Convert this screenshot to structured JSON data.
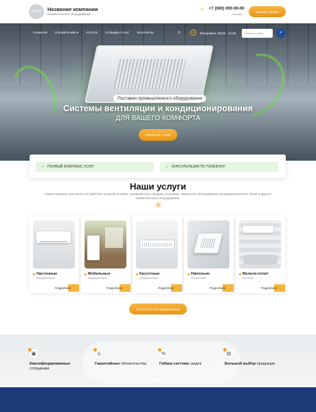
{
  "header": {
    "logo_text": "LOGO",
    "company_name": "Название компании",
    "company_sub": "Климатическое оборудование",
    "phone": "+7 (000) 000-00-00",
    "city": "г.Москва",
    "cta": "Заказать звонок"
  },
  "nav": {
    "items": [
      "Главная",
      "О компании",
      "Услуги",
      "Отзывы о нас",
      "Контакты"
    ],
    "hours": "Ежедневно: 09:00 - 21:00",
    "search_placeholder": "Поиск по сайту"
  },
  "hero": {
    "pill": "Поставки промышленного оборудования",
    "title": "Системы вентиляции и кондиционирования",
    "subtitle": "для вашего комфорта",
    "cta": "Связаться с нами"
  },
  "features": [
    "Полный комплекс услуг",
    "Консультация по телефону"
  ],
  "services": {
    "title": "Наши услуги",
    "description": "Наша компания уже много лет работает на рынке и имеет огромный опыт продаж, установки, сервисного обслуживания кондиционеров всех типов и другого климатического оборудования.",
    "items": [
      {
        "name": "Настенные",
        "sub": "кондиционеры",
        "more": "Подробнее"
      },
      {
        "name": "Мобильные",
        "sub": "кондиционеры",
        "more": "Подробнее"
      },
      {
        "name": "Кассетные",
        "sub": "кондиционеры",
        "more": "Подробнее"
      },
      {
        "name": "Напольно",
        "sub": "потолочные",
        "more": "Подробнее"
      },
      {
        "name": "Мульти-сплит",
        "sub": "системы",
        "more": "Подробнее"
      }
    ],
    "cta": "Посмотреть все предложения"
  },
  "advantages": [
    {
      "bold": "Квалифицированные",
      "rest": "сотрудники",
      "icon": "certificate-icon"
    },
    {
      "bold": "Гарантийные",
      "rest": "обязательства",
      "icon": "badge-icon"
    },
    {
      "bold": "Гибкая система",
      "rest": "скидок",
      "icon": "discount-icon"
    },
    {
      "bold": "Большой выбор",
      "rest": "продукции",
      "icon": "catalog-icon"
    }
  ],
  "colors": {
    "accent": "#ea9616",
    "brand_blue": "#1a3b78",
    "feature_bg": "#e6f4e1"
  }
}
